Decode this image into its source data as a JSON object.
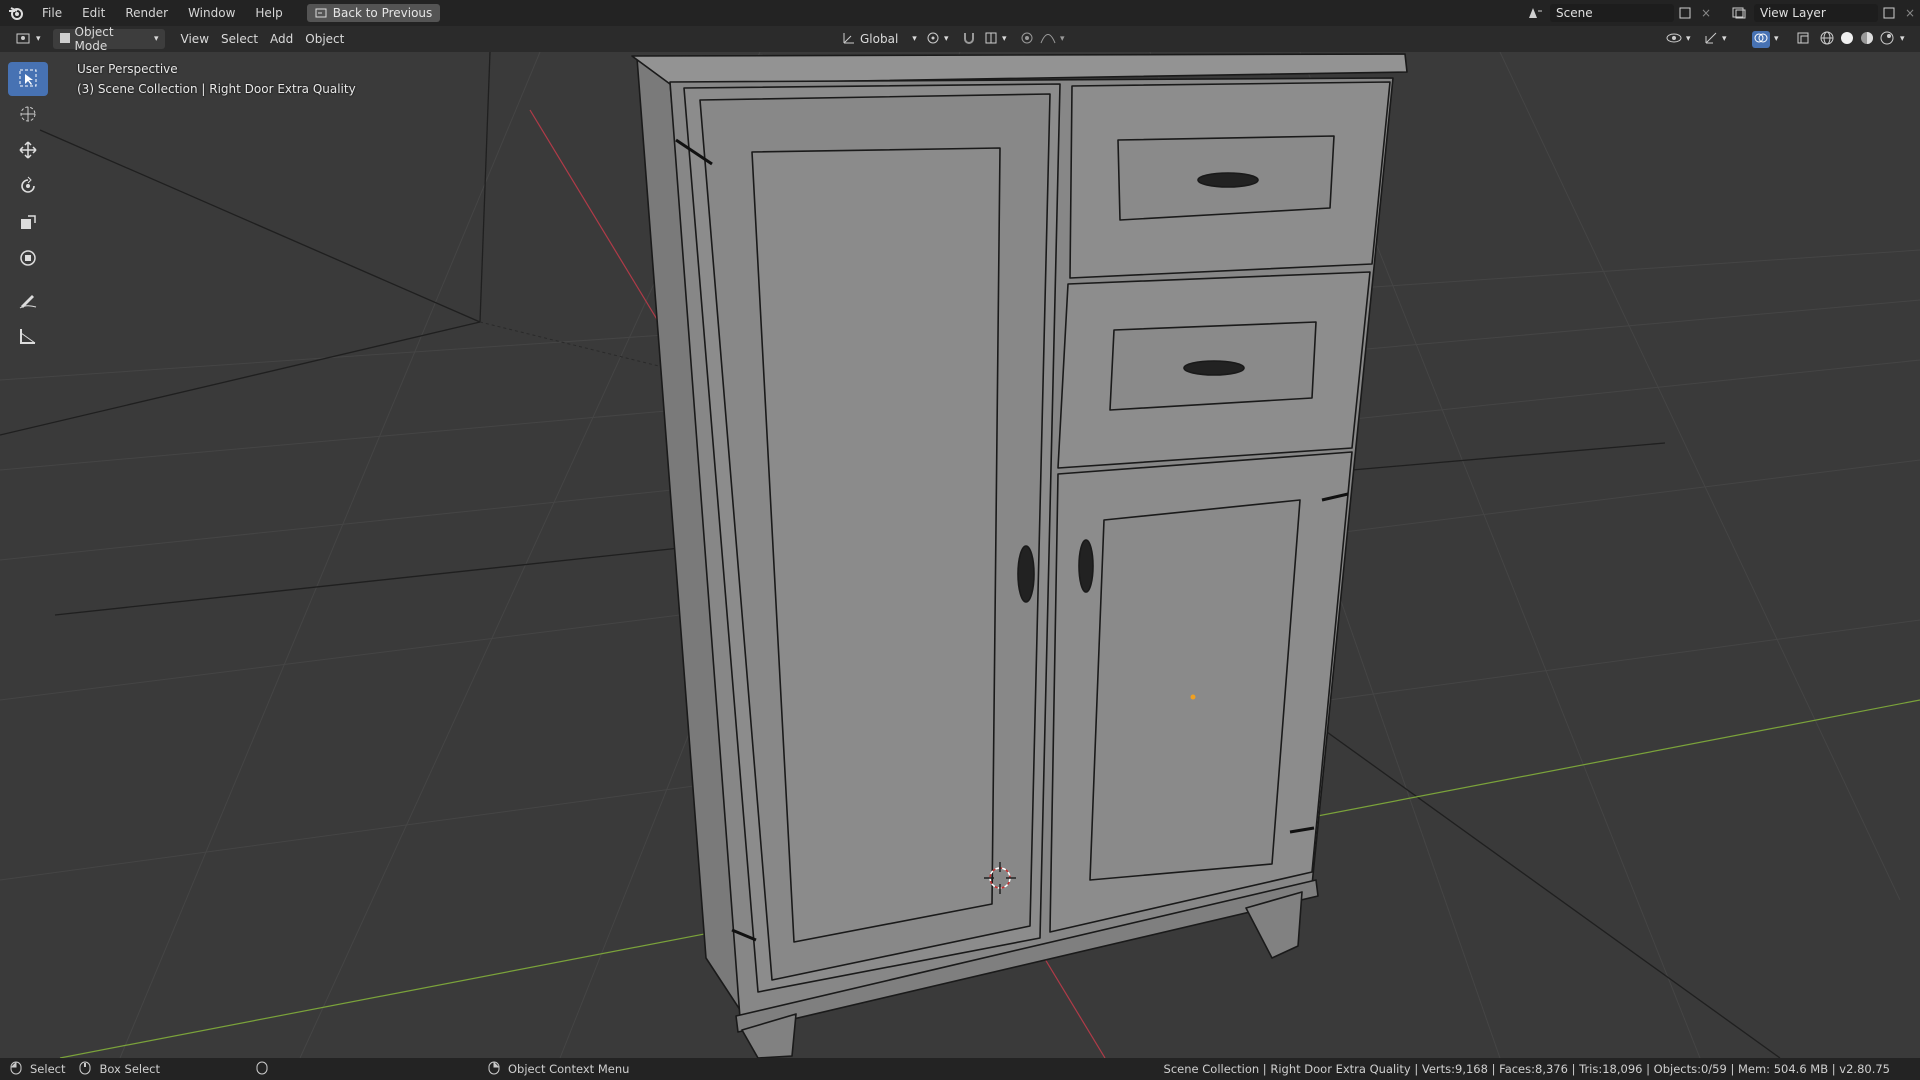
{
  "menu": {
    "items": [
      "File",
      "Edit",
      "Render",
      "Window",
      "Help"
    ],
    "back_label": "Back to Previous"
  },
  "top_right": {
    "scene_name": "Scene",
    "view_layer": "View Layer"
  },
  "viewport_header": {
    "mode": "Object Mode",
    "menus": [
      "View",
      "Select",
      "Add",
      "Object"
    ],
    "orientation": "Global"
  },
  "viewport": {
    "perspective": "User Perspective",
    "collection_info": "(3) Scene Collection | Right Door Extra Quality"
  },
  "status": {
    "select": "Select",
    "box_select": "Box Select",
    "context_menu": "Object Context Menu",
    "stats": "Scene Collection | Right Door Extra Quality | Verts:9,168 | Faces:8,376 | Tris:18,096 | Objects:0/59 | Mem: 504.6 MB | v2.80.75"
  },
  "colors": {
    "accent": "#4772b3",
    "x_axis": "#b03a48",
    "y_axis": "#7ba33a",
    "model": "#8a8a8a"
  },
  "icons": [
    "blender-logo-icon",
    "back-icon",
    "scene-icon",
    "view-layer-icon",
    "editor-type-icon",
    "object-mode-icon",
    "select-box-icon",
    "cursor-icon",
    "move-icon",
    "rotate-icon",
    "scale-icon",
    "transform-icon",
    "annotate-icon",
    "measure-icon",
    "mouse-left-icon",
    "mouse-middle-icon",
    "mouse-right-icon"
  ]
}
